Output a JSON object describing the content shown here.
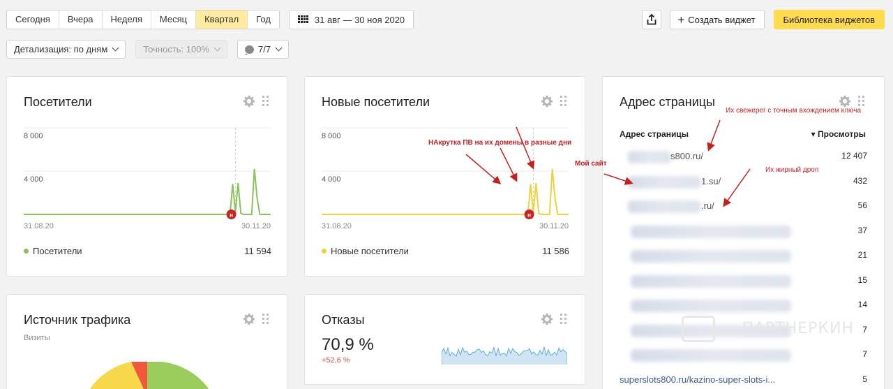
{
  "periods": [
    "Сегодня",
    "Вчера",
    "Неделя",
    "Месяц",
    "Квартал",
    "Год"
  ],
  "active_period": 4,
  "date_range": "31 авг — 30 ноя 2020",
  "toolbar": {
    "create_widget": "Создать виджет",
    "library": "Библиотека виджетов",
    "detail": "Детализация: по дням",
    "accuracy": "Точность: 100%",
    "comments": "7/7"
  },
  "visitors": {
    "title": "Посетители",
    "y_ticks": [
      "8 000",
      "4 000"
    ],
    "x_start": "31.08.20",
    "x_end": "30.11.20",
    "legend": "Посетители",
    "total": "11 594",
    "color": "#8ac25a"
  },
  "new_visitors": {
    "title": "Новые посетители",
    "y_ticks": [
      "8 000",
      "4 000"
    ],
    "x_start": "31.08.20",
    "x_end": "30.11.20",
    "legend": "Новые посетители",
    "total": "11 586",
    "color": "#f2d03b"
  },
  "traffic": {
    "title": "Источник трафика",
    "subtitle": "Визиты"
  },
  "bounce": {
    "title": "Отказы",
    "value": "70,9 %",
    "delta": "+52,6 %"
  },
  "pages": {
    "title": "Адрес страницы",
    "col_url": "Адрес страницы",
    "col_views": "▾ Просмотры",
    "rows": [
      {
        "url": "s800.ru/",
        "views": "12 407"
      },
      {
        "url": "1.su/",
        "views": "432"
      },
      {
        "url": ".ru/",
        "views": "56"
      },
      {
        "url": "",
        "views": "37"
      },
      {
        "url": "",
        "views": "21"
      },
      {
        "url": "",
        "views": "15"
      },
      {
        "url": "",
        "views": "14"
      },
      {
        "url": "",
        "views": "7"
      },
      {
        "url": "",
        "views": "7"
      },
      {
        "url": "superslots800.ru/kazino-super-slots-i...",
        "views": "5"
      }
    ]
  },
  "annotations": {
    "nakrutka": "НАкрутка ПВ на их домены в разные дни",
    "my_site": "Мой сайт",
    "sveje": "Их свежерег с точным вхождением ключа",
    "drop": "Их жирный дроп"
  },
  "watermark": "ПАРТНЕРКИН",
  "chart_data": [
    {
      "type": "line",
      "title": "Посетители",
      "x_range": [
        "31.08.20",
        "30.11.20"
      ],
      "ylim": [
        0,
        8000
      ],
      "series": [
        {
          "name": "Посетители",
          "values": [
            0,
            0,
            0,
            0,
            0,
            0,
            0,
            0,
            0,
            0,
            0,
            0,
            0,
            0,
            0,
            0,
            0,
            0,
            0,
            0,
            0,
            0,
            0,
            0,
            0,
            0,
            0,
            0,
            0,
            0,
            0,
            0,
            0,
            0,
            0,
            0,
            0,
            0,
            0,
            0,
            0,
            0,
            0,
            0,
            0,
            0,
            0,
            0,
            0,
            0,
            0,
            0,
            0,
            0,
            0,
            0,
            0,
            0,
            0,
            0,
            0,
            0,
            0,
            0,
            0,
            0,
            0,
            0,
            0,
            0,
            0,
            0,
            0,
            0,
            0,
            0,
            0,
            2800,
            200,
            2900,
            100,
            0,
            0,
            0,
            0,
            4200,
            1500,
            0,
            0,
            0,
            0,
            0
          ]
        }
      ]
    },
    {
      "type": "line",
      "title": "Новые посетители",
      "x_range": [
        "31.08.20",
        "30.11.20"
      ],
      "ylim": [
        0,
        8000
      ],
      "series": [
        {
          "name": "Новые посетители",
          "values": [
            0,
            0,
            0,
            0,
            0,
            0,
            0,
            0,
            0,
            0,
            0,
            0,
            0,
            0,
            0,
            0,
            0,
            0,
            0,
            0,
            0,
            0,
            0,
            0,
            0,
            0,
            0,
            0,
            0,
            0,
            0,
            0,
            0,
            0,
            0,
            0,
            0,
            0,
            0,
            0,
            0,
            0,
            0,
            0,
            0,
            0,
            0,
            0,
            0,
            0,
            0,
            0,
            0,
            0,
            0,
            0,
            0,
            0,
            0,
            0,
            0,
            0,
            0,
            0,
            0,
            0,
            0,
            0,
            0,
            0,
            0,
            0,
            0,
            0,
            0,
            0,
            0,
            2800,
            200,
            2900,
            100,
            0,
            0,
            0,
            0,
            4200,
            1500,
            0,
            0,
            0,
            0,
            0
          ]
        }
      ]
    }
  ]
}
